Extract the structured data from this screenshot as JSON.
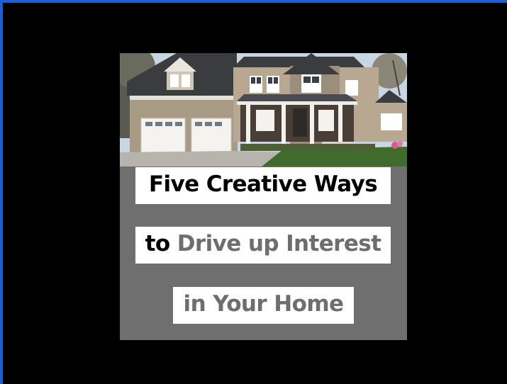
{
  "card": {
    "image_alt": "Two-story house with a two-car garage and front porch",
    "headline": {
      "line1": "Five Creative Ways",
      "line2_prefix": "to",
      "line2_rest": "Drive up Interest",
      "line3": "in Your Home"
    }
  },
  "colors": {
    "border": "#1a5fd6",
    "background": "#000000",
    "card": "#6f6f6f",
    "text_dark": "#000000",
    "text_grey": "#6e6e6e"
  }
}
